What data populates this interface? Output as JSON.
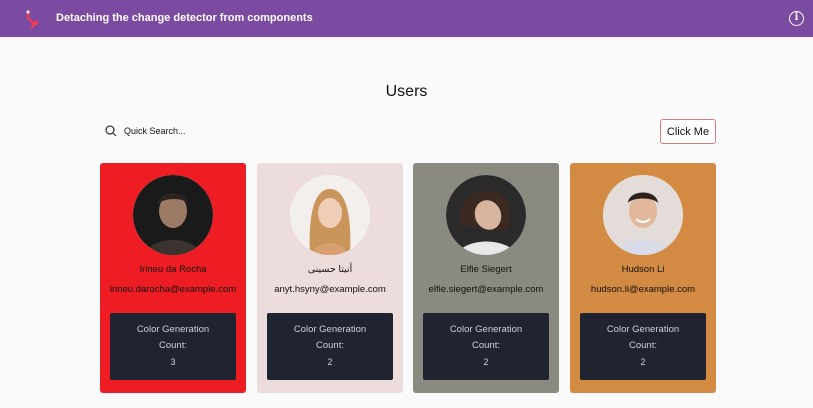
{
  "app": {
    "title": "Detaching the change detector from components"
  },
  "page": {
    "heading": "Users"
  },
  "search": {
    "placeholder": "Quick Search..."
  },
  "toolbar": {
    "click_label": "Click Me"
  },
  "colors": {
    "topbar": "#7b4ba1",
    "count_box": "#1f2430"
  },
  "users": [
    {
      "name": "Irineu da Rocha",
      "email": "irineu.darocha@example.com",
      "count_label_1": "Color Generation",
      "count_label_2": "Count:",
      "count": "3",
      "card_color": "#ee1d24"
    },
    {
      "name": "أنيتا حسینی",
      "email": "anyt.hsyny@example.com",
      "count_label_1": "Color Generation",
      "count_label_2": "Count:",
      "count": "2",
      "card_color": "#ecdcdb"
    },
    {
      "name": "Elfie Siegert",
      "email": "elfie.siegert@example.com",
      "count_label_1": "Color Generation",
      "count_label_2": "Count:",
      "count": "2",
      "card_color": "#8a8a80"
    },
    {
      "name": "Hudson Li",
      "email": "hudson.li@example.com",
      "count_label_1": "Color Generation",
      "count_label_2": "Count:",
      "count": "2",
      "card_color": "#d38a42"
    }
  ]
}
